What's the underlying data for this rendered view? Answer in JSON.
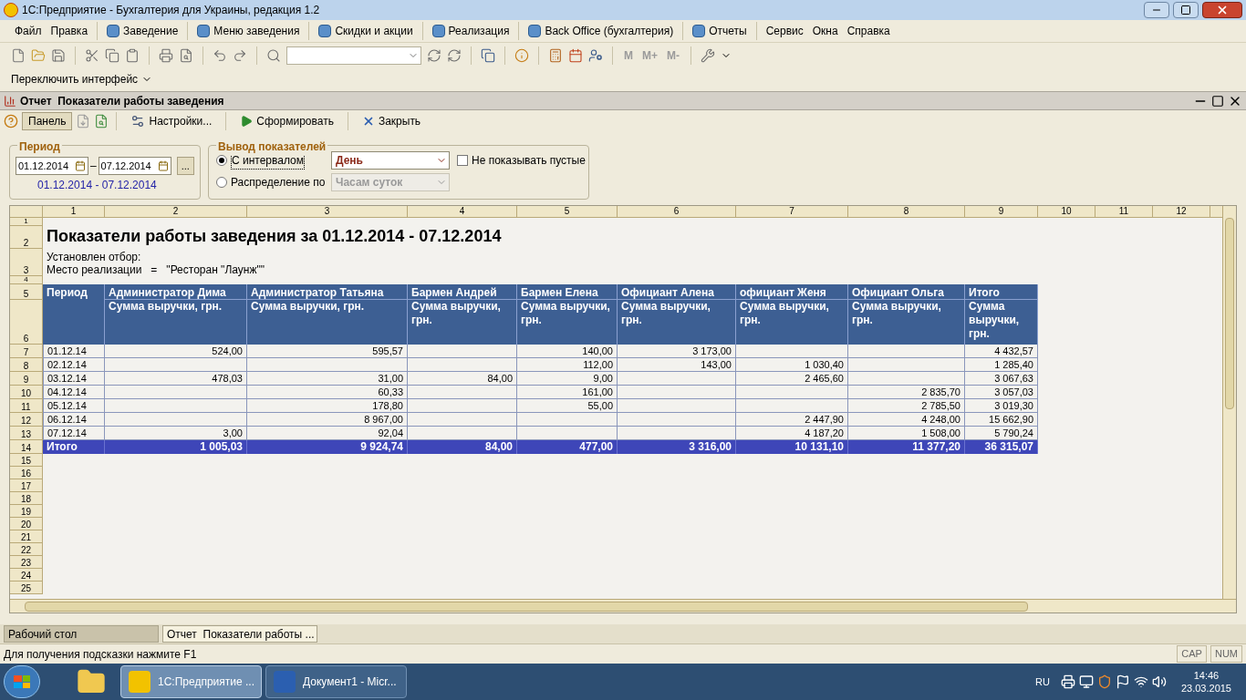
{
  "window": {
    "title": "1С:Предприятие - Бухгалтерия для Украины, редакция 1.2"
  },
  "menu": [
    {
      "label": "Файл",
      "kind": "plain"
    },
    {
      "label": "Правка",
      "kind": "plain"
    },
    {
      "label": "Заведение",
      "kind": "icon"
    },
    {
      "label": "Меню заведения",
      "kind": "icon"
    },
    {
      "label": "Скидки и акции",
      "kind": "icon"
    },
    {
      "label": "Реализация",
      "kind": "icon"
    },
    {
      "label": "Back Office (бухгалтерия)",
      "kind": "icon"
    },
    {
      "label": "Отчеты",
      "kind": "icon"
    },
    {
      "label": "Сервис",
      "kind": "plain"
    },
    {
      "label": "Окна",
      "kind": "plain"
    },
    {
      "label": "Справка",
      "kind": "plain"
    }
  ],
  "toolbar": {
    "memory_buttons": [
      "M",
      "M+",
      "M-"
    ]
  },
  "interface_switch": {
    "label": "Переключить интерфейс"
  },
  "document": {
    "title": "Отчет  Показатели работы заведения",
    "toolbar": [
      {
        "label": "Панель",
        "kind": "toggle",
        "pressed": true
      },
      {
        "label": "Настройки...",
        "kind": "settings",
        "pressed": false
      },
      {
        "label": "Сформировать",
        "kind": "run",
        "pressed": false
      },
      {
        "label": "Закрыть",
        "kind": "close",
        "pressed": false
      }
    ],
    "period": {
      "legend": "Период",
      "from": "01.12.2014",
      "separator": "–",
      "to": "07.12.2014",
      "more": "...",
      "summary": "01.12.2014 - 07.12.2014"
    },
    "output": {
      "legend": "Вывод показателей",
      "options": [
        {
          "label": "С интервалом",
          "selected": true,
          "value": "День",
          "disabled": false
        },
        {
          "label": "Распределение по",
          "selected": false,
          "value": "Часам суток",
          "disabled": true
        }
      ],
      "hide_empty": {
        "label": "Не показывать пустые",
        "checked": false
      }
    }
  },
  "sheet": {
    "column_numbers": [
      "1",
      "2",
      "3",
      "4",
      "5",
      "6",
      "7",
      "8",
      "9",
      "10",
      "11",
      "12"
    ],
    "row_numbers": [
      "1",
      "2",
      "3",
      "4",
      "5",
      "6",
      "7",
      "8",
      "9",
      "10",
      "11",
      "12",
      "13",
      "14",
      "15",
      "16",
      "17",
      "18",
      "19",
      "20",
      "21",
      "22",
      "23",
      "24",
      "25"
    ],
    "title": "Показатели работы заведения за 01.12.2014 - 07.12.2014",
    "filter_label": "Установлен отбор:",
    "filter_text": "Место реализации   =   \"Ресторан \"Лаунж\"\"",
    "columns": [
      {
        "name": "Период"
      },
      {
        "name": "Администратор Дима",
        "subheader": "Сумма выручки, грн."
      },
      {
        "name": "Администратор Татьяна",
        "subheader": "Сумма выручки, грн."
      },
      {
        "name": "Бармен Андрей",
        "subheader": "Сумма выручки, грн."
      },
      {
        "name": "Бармен Елена",
        "subheader": "Сумма выручки, грн."
      },
      {
        "name": "Официант Алена",
        "subheader": "Сумма выручки, грн."
      },
      {
        "name": "официант Женя",
        "subheader": "Сумма выручки, грн."
      },
      {
        "name": "Официант Ольга",
        "subheader": "Сумма выручки, грн."
      },
      {
        "name": "Итого",
        "subheader": "Сумма выручки, грн."
      }
    ],
    "rows": [
      {
        "period": "01.12.14",
        "c2": "524,00",
        "c3": "595,57",
        "c5": "140,00",
        "c6": "3 173,00",
        "c9": "4 432,57"
      },
      {
        "period": "02.12.14",
        "c5": "112,00",
        "c6": "143,00",
        "c7": "1 030,40",
        "c9": "1 285,40"
      },
      {
        "period": "03.12.14",
        "c2": "478,03",
        "c3": "31,00",
        "c4": "84,00",
        "c5": "9,00",
        "c7": "2 465,60",
        "c9": "3 067,63"
      },
      {
        "period": "04.12.14",
        "c3": "60,33",
        "c5": "161,00",
        "c8": "2 835,70",
        "c9": "3 057,03"
      },
      {
        "period": "05.12.14",
        "c3": "178,80",
        "c5": "55,00",
        "c8": "2 785,50",
        "c9": "3 019,30"
      },
      {
        "period": "06.12.14",
        "c3": "8 967,00",
        "c7": "2 447,90",
        "c8": "4 248,00",
        "c9": "15 662,90"
      },
      {
        "period": "07.12.14",
        "c2": "3,00",
        "c3": "92,04",
        "c7": "4 187,20",
        "c8": "1 508,00",
        "c9": "5 790,24"
      }
    ],
    "total": {
      "label": "Итого",
      "values": [
        "1 005,03",
        "9 924,74",
        "84,00",
        "477,00",
        "3 316,00",
        "10 131,10",
        "11 377,20",
        "36 315,07"
      ]
    }
  },
  "window_tabs": [
    {
      "label": "Рабочий стол",
      "selected": false
    },
    {
      "label": "Отчет  Показатели работы ...",
      "selected": true
    }
  ],
  "status_bar": {
    "hint": "Для получения подсказки нажмите F1",
    "indicators": [
      "CAP",
      "NUM"
    ]
  },
  "taskbar": {
    "tasks": [
      {
        "label": "1С:Предприятие ...",
        "selected": true
      },
      {
        "label": "Документ1 - Micr...",
        "selected": false
      }
    ],
    "language": "RU",
    "time": "14:46",
    "date": "23.03.2015"
  }
}
